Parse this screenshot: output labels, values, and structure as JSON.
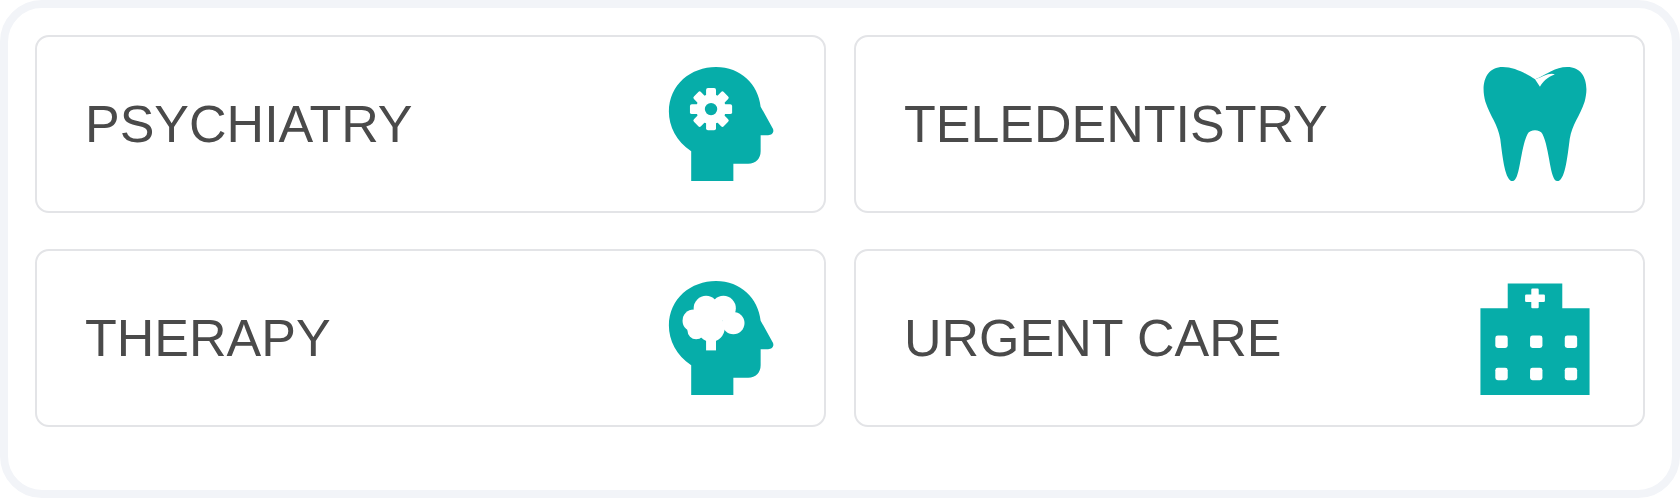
{
  "services": [
    {
      "label": "PSYCHIATRY"
    },
    {
      "label": "TELEDENTISTRY"
    },
    {
      "label": "THERAPY"
    },
    {
      "label": "URGENT CARE"
    }
  ]
}
